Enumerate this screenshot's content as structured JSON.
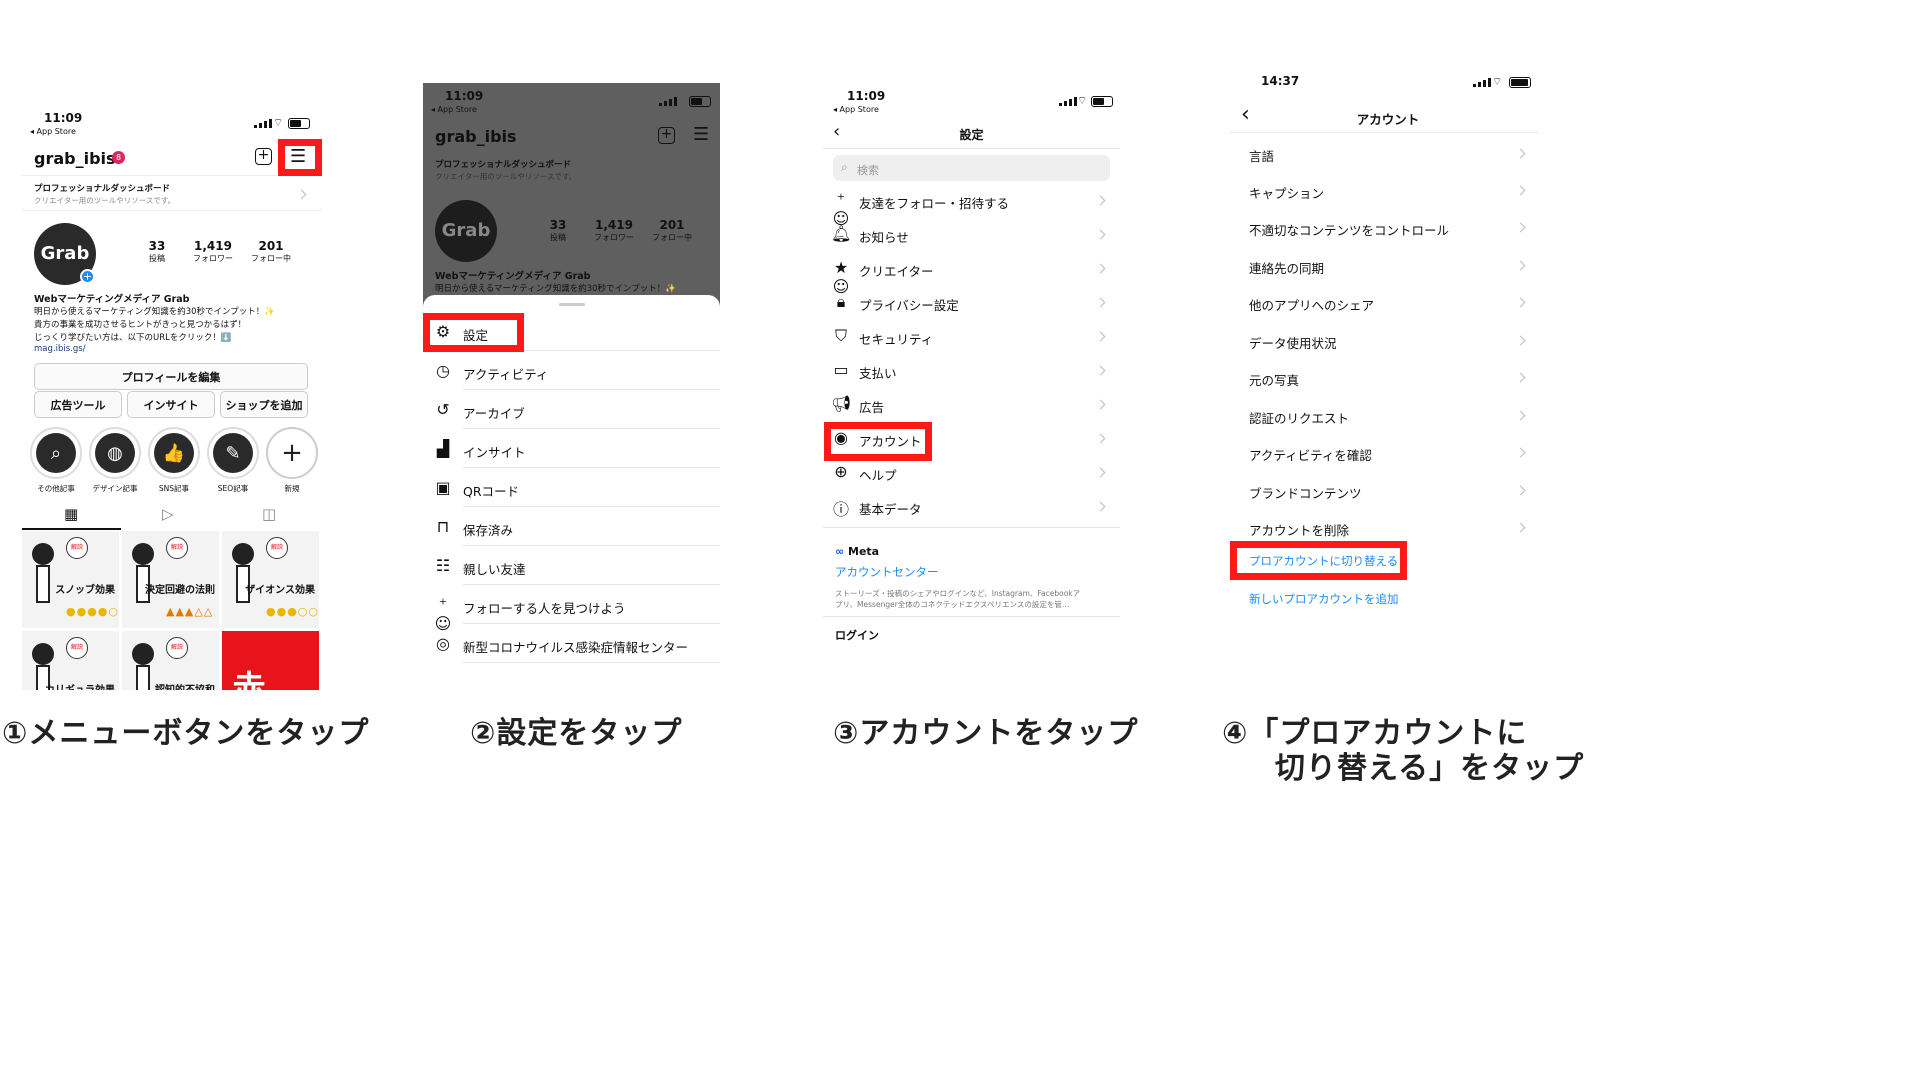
{
  "captions": {
    "c1": "①メニューボタンをタップ",
    "c2": "②設定をタップ",
    "c3": "③アカウントをタップ",
    "c4_line1": "④「プロアカウントに",
    "c4_line2": "切り替える」をタップ"
  },
  "colors": {
    "highlight_red": "#ff1a1a",
    "link_blue": "#1a8cff",
    "meta_blue": "#0866ff"
  },
  "screen1": {
    "time": "11:09",
    "back_app": "◂ App Store",
    "username": "grab_ibis",
    "notif_count": "8",
    "dashboard_title": "プロフェッショナルダッシュボード",
    "dashboard_sub": "クリエイター用のツールやリソースです。",
    "avatar_text": "Grab",
    "stats": [
      {
        "num": "33",
        "label": "投稿"
      },
      {
        "num": "1,419",
        "label": "フォロワー"
      },
      {
        "num": "201",
        "label": "フォロー中"
      }
    ],
    "bio_name": "Webマーケティングメディア Grab",
    "bio_lines": [
      "明日から使えるマーケティング知識を約30秒でインプット！✨",
      "貴方の事業を成功させるヒントがきっと見つかるはず！",
      "じっくり学びたい方は、以下のURLをクリック！⬇️"
    ],
    "bio_link": "mag.ibis.gs/",
    "edit_profile": "プロフィールを編集",
    "buttons": [
      "広告ツール",
      "インサイト",
      "ショップを追加"
    ],
    "highlights": [
      {
        "icon": "search-icon",
        "label": "その他記事"
      },
      {
        "icon": "palette-icon",
        "label": "デザイン記事"
      },
      {
        "icon": "thumbs-up-icon",
        "label": "SNS記事"
      },
      {
        "icon": "edit-icon",
        "label": "SEO記事"
      },
      {
        "icon": "plus-icon",
        "label": "新規"
      }
    ],
    "posts": [
      "スノッブ効果",
      "決定回避の法則",
      "ザイオンス効果",
      "カリギュラ効果",
      "認知的不協和",
      "赤"
    ]
  },
  "screen2": {
    "time": "11:09",
    "back_app": "◂ App Store",
    "username": "grab_ibis",
    "dashboard_title": "プロフェッショナルダッシュボード",
    "dashboard_sub": "クリエイター用のツールやリソースです。",
    "stats": [
      {
        "num": "33",
        "label": "投稿"
      },
      {
        "num": "1,419",
        "label": "フォロワー"
      },
      {
        "num": "201",
        "label": "フォロー中"
      }
    ],
    "bio_name": "Webマーケティングメディア Grab",
    "bio_line": "明日から使えるマーケティング知識を約30秒でインプット！✨",
    "menu": [
      {
        "icon": "gear-icon",
        "label": "設定"
      },
      {
        "icon": "activity-icon",
        "label": "アクティビティ"
      },
      {
        "icon": "archive-icon",
        "label": "アーカイブ"
      },
      {
        "icon": "insights-icon",
        "label": "インサイト"
      },
      {
        "icon": "qr-code-icon",
        "label": "QRコード"
      },
      {
        "icon": "bookmark-icon",
        "label": "保存済み"
      },
      {
        "icon": "close-friends-icon",
        "label": "親しい友達"
      },
      {
        "icon": "add-person-icon",
        "label": "フォローする人を見つけよう"
      },
      {
        "icon": "covid-info-icon",
        "label": "新型コロナウイルス感染症情報センター"
      }
    ]
  },
  "screen3": {
    "time": "11:09",
    "back_app": "◂ App Store",
    "title": "設定",
    "search_placeholder": "検索",
    "rows": [
      {
        "icon": "add-person-icon",
        "label": "友達をフォロー・招待する"
      },
      {
        "icon": "bell-icon",
        "label": "お知らせ"
      },
      {
        "icon": "creator-icon",
        "label": "クリエイター"
      },
      {
        "icon": "lock-icon",
        "label": "プライバシー設定"
      },
      {
        "icon": "shield-icon",
        "label": "セキュリティ"
      },
      {
        "icon": "card-icon",
        "label": "支払い"
      },
      {
        "icon": "megaphone-icon",
        "label": "広告"
      },
      {
        "icon": "account-icon",
        "label": "アカウント"
      },
      {
        "icon": "help-icon",
        "label": "ヘルプ"
      },
      {
        "icon": "info-icon",
        "label": "基本データ"
      }
    ],
    "meta_label": "Meta",
    "account_center": "アカウントセンター",
    "meta_desc_1": "ストーリーズ・投稿のシェアやログインなど、Instagram、Facebookア",
    "meta_desc_2": "プリ、Messenger全体のコネクテッドエクスペリエンスの設定を管…",
    "login": "ログイン"
  },
  "screen4": {
    "time": "14:37",
    "title": "アカウント",
    "rows": [
      "言語",
      "キャプション",
      "不適切なコンテンツをコントロール",
      "連絡先の同期",
      "他のアプリへのシェア",
      "データ使用状況",
      "元の写真",
      "認証のリクエスト",
      "アクティビティを確認",
      "ブランドコンテンツ",
      "アカウントを削除"
    ],
    "switch_pro": "プロアカウントに切り替える",
    "add_pro": "新しいプロアカウントを追加"
  }
}
